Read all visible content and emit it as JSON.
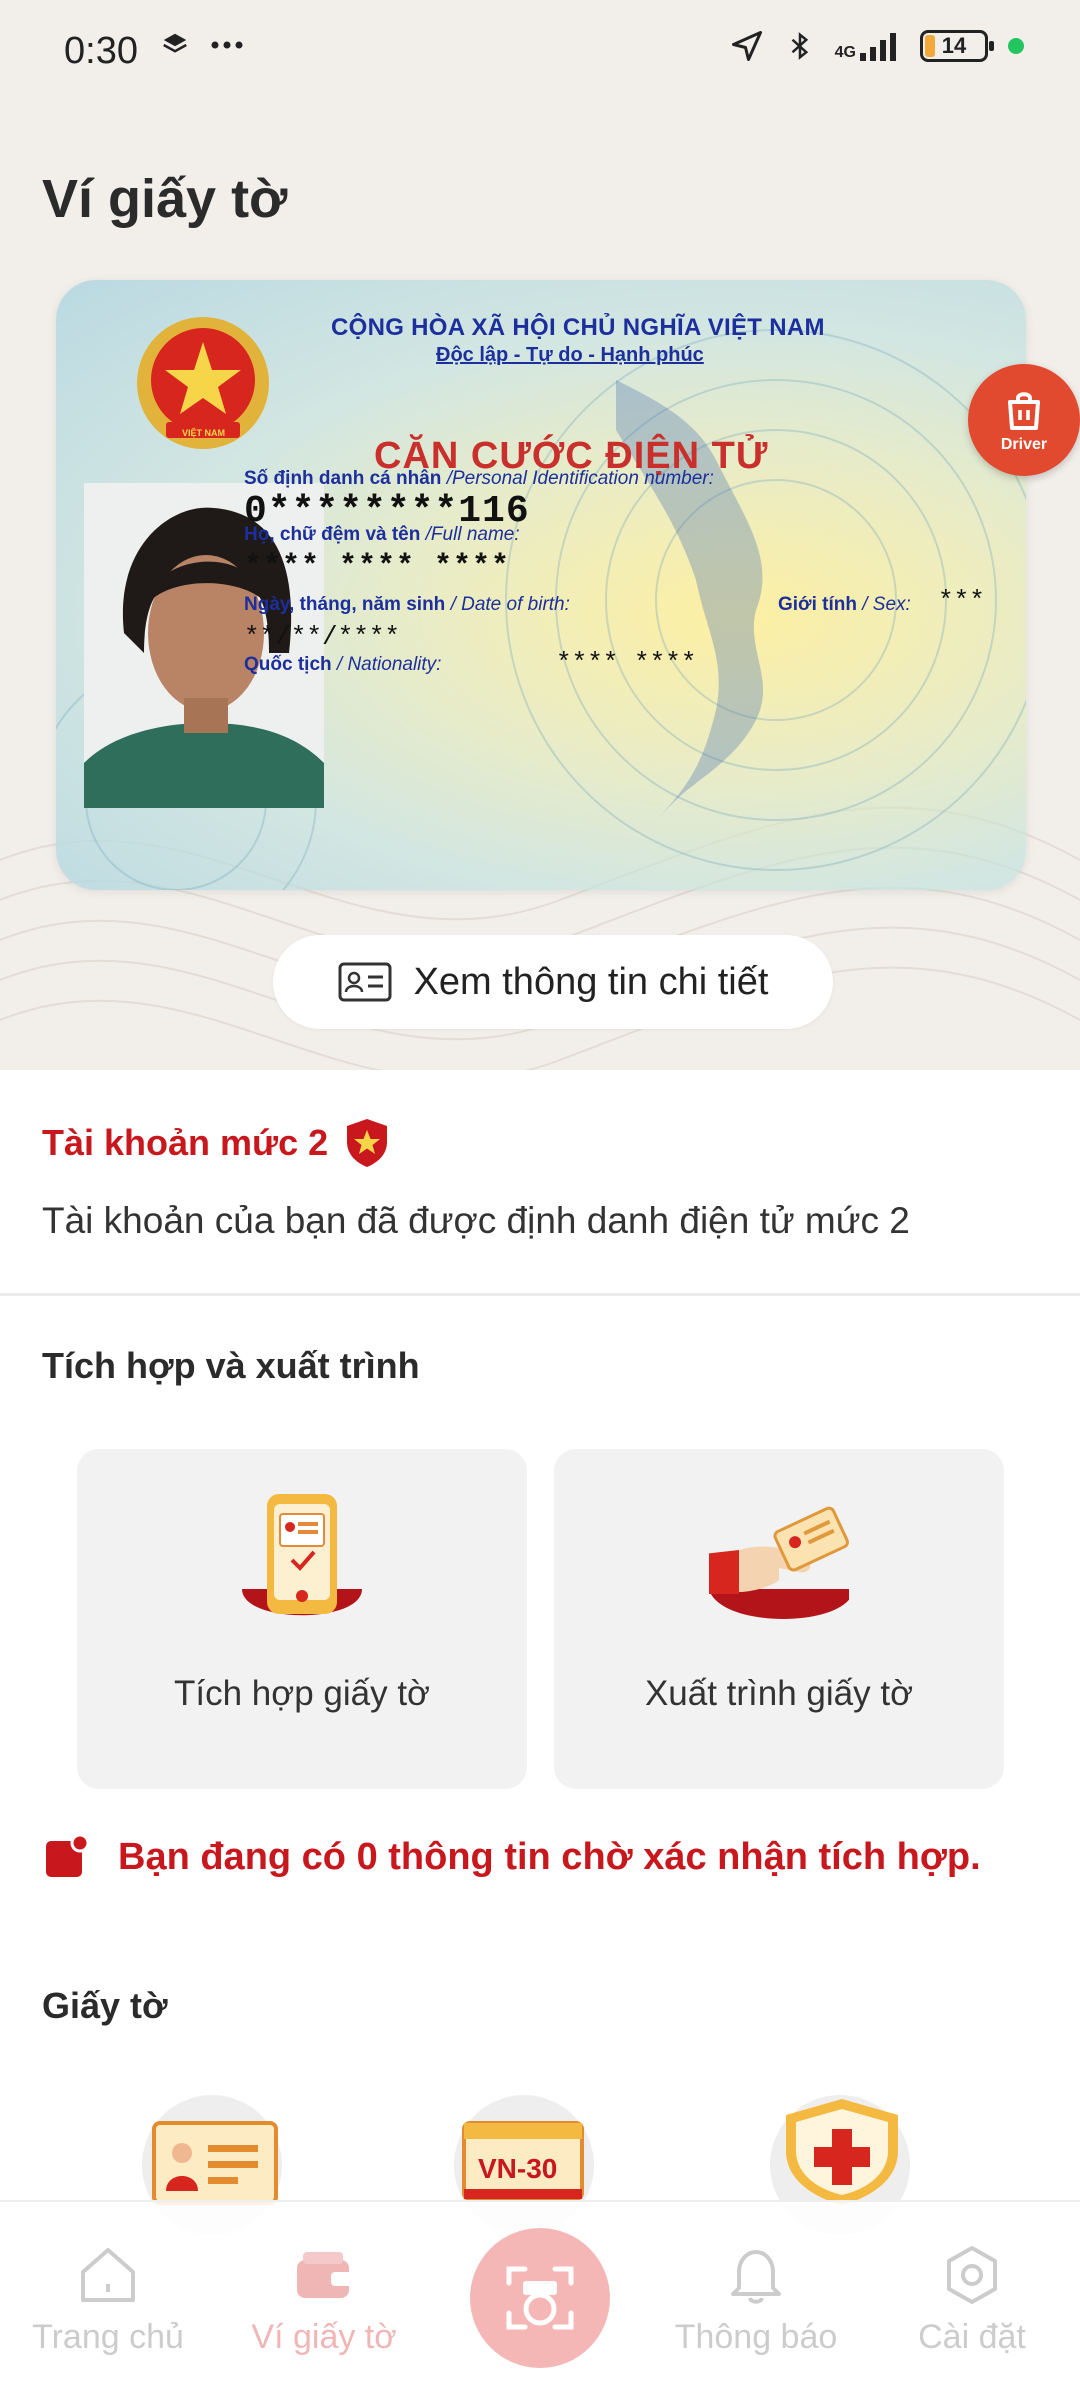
{
  "status_bar": {
    "time": "0:30",
    "network": "4G",
    "battery": "14",
    "icons": [
      "layers-icon",
      "more-icon",
      "location-arrow-icon",
      "bluetooth-icon",
      "signal-icon",
      "battery-icon"
    ]
  },
  "header": {
    "title": "Ví giấy tờ"
  },
  "id_card": {
    "country_line1": "CỘNG HÒA XÃ HỘI CHỦ NGHĨA VIỆT NAM",
    "country_line2": "Độc lập - Tự do - Hạnh phúc",
    "card_type": "CĂN CƯỚC ĐIỆN TỬ",
    "id_label": "Số định danh cá nhân",
    "id_label_en": "/Personal Identification number:",
    "id_value": "0********116",
    "name_label": "Họ, chữ đệm và tên",
    "name_label_en": "/Full name:",
    "name_value": "**** **** ****",
    "dob_label": "Ngày, tháng, năm sinh",
    "dob_label_en": "/ Date of birth:",
    "dob_value": "**/**/****",
    "sex_label": "Giới tính",
    "sex_label_en": "/ Sex:",
    "sex_value": "***",
    "nationality_label": "Quốc tịch",
    "nationality_label_en": "/ Nationality:",
    "nationality_value": "**** ****",
    "emblem_text": "VIỆT NAM"
  },
  "driver_badge": {
    "label": "Driver"
  },
  "detail_button": {
    "label": "Xem thông tin chi tiết"
  },
  "account": {
    "title": "Tài khoản mức 2",
    "description": "Tài khoản của bạn đã được định danh điện tử mức 2"
  },
  "integration": {
    "section_title": "Tích hợp và xuất trình",
    "tiles": [
      {
        "label": "Tích hợp giấy tờ",
        "icon": "phone-document-icon"
      },
      {
        "label": "Xuất trình giấy tờ",
        "icon": "hand-card-icon"
      }
    ]
  },
  "pending": {
    "text": "Bạn đang có 0 thông tin chờ xác nhận tích hợp."
  },
  "documents": {
    "section_title": "Giấy tờ",
    "items": [
      {
        "icon": "id-card-doc-icon"
      },
      {
        "icon": "vehicle-plate-icon",
        "text": "VN-30"
      },
      {
        "icon": "health-shield-icon"
      }
    ]
  },
  "bottom_nav": {
    "items": [
      {
        "label": "Trang chủ",
        "icon": "home-icon"
      },
      {
        "label": "Ví giấy tờ",
        "icon": "wallet-icon",
        "active": true
      },
      {
        "label": "Thông báo",
        "icon": "bell-icon"
      },
      {
        "label": "Cài đặt",
        "icon": "settings-icon"
      }
    ],
    "scan_icon": "scan-icon"
  },
  "colors": {
    "brand_red": "#c8181e",
    "header_bg": "#f2eeea",
    "card_blue_text": "#1c2f9c",
    "card_red_text": "#c9302c"
  }
}
